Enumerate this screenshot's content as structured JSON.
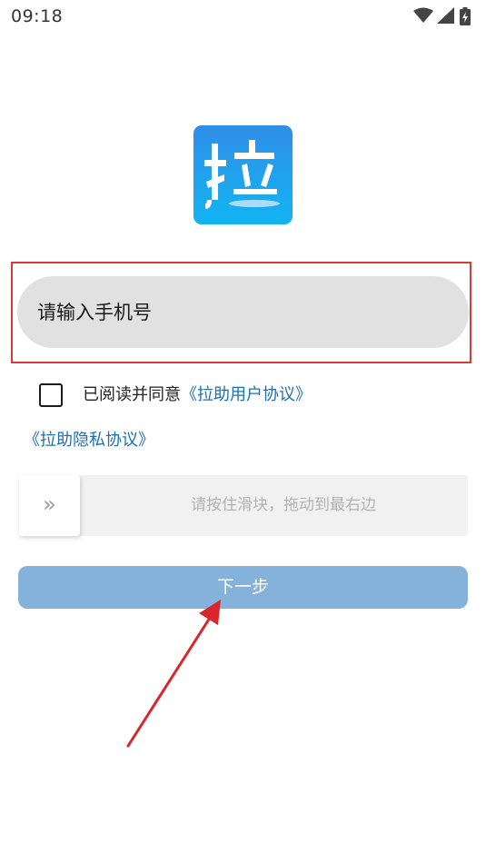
{
  "status_bar": {
    "time": "09:18",
    "icons": [
      "wifi-icon",
      "signal-icon",
      "battery-charging-icon"
    ]
  },
  "logo": {
    "icon": "app-logo-la",
    "text": "拉",
    "colors": {
      "top": "#2f8fe8",
      "bottom": "#12b4f2"
    }
  },
  "login": {
    "phone_placeholder": "请输入手机号",
    "phone_value": ""
  },
  "agreement": {
    "checked": false,
    "text": "已阅读并同意",
    "user_agreement_link": "《拉助用户协议》",
    "privacy_link": "《拉助隐私协议》"
  },
  "slider": {
    "handle_glyph": "»",
    "hint": "请按住滑块，拖动到最右边",
    "progress": 0
  },
  "next_button": {
    "label": "下一步",
    "color": "#85b2da"
  },
  "colors": {
    "link": "#1f6fb0",
    "highlight_box": "#d63a3a",
    "annotation_arrow": "#d9262b"
  }
}
